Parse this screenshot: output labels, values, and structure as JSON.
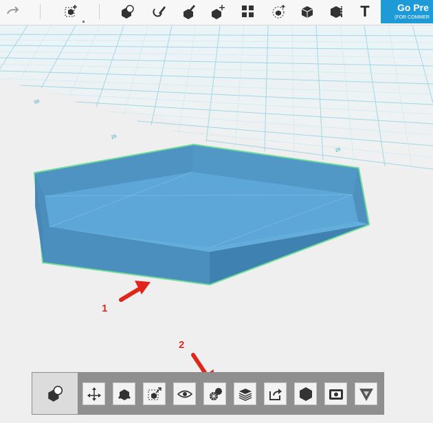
{
  "top_toolbar": {
    "tools": [
      {
        "name": "redo-icon"
      },
      {
        "name": "transform-icon"
      },
      {
        "name": "primitives-icon"
      },
      {
        "name": "sketch-icon"
      },
      {
        "name": "construct-icon"
      },
      {
        "name": "modify-icon"
      },
      {
        "name": "pattern-icon"
      },
      {
        "name": "grouping-icon"
      },
      {
        "name": "combine-icon"
      },
      {
        "name": "measure-icon"
      },
      {
        "name": "text-icon"
      }
    ],
    "text_tool_label": "T",
    "go_premium": {
      "label": "Go Pre",
      "sub_label": "(FOR COMMER"
    }
  },
  "grid": {
    "labels": [
      "50",
      "25",
      "25"
    ]
  },
  "annotations": [
    {
      "label": "1"
    },
    {
      "label": "2"
    }
  ],
  "colors": {
    "accent": "#1e9ad6",
    "model": "#5aa7d6",
    "selection": "#6fdc9a",
    "annotation": "#e0251b"
  },
  "bottom_toolbar": {
    "tools": [
      {
        "name": "shape-icon"
      },
      {
        "name": "move-icon"
      },
      {
        "name": "smart-scale-icon"
      },
      {
        "name": "scale-icon"
      },
      {
        "name": "hide-icon"
      },
      {
        "name": "material-icon"
      },
      {
        "name": "slice-icon"
      },
      {
        "name": "export-icon"
      },
      {
        "name": "solid-icon"
      },
      {
        "name": "snapshot-icon"
      },
      {
        "name": "print-icon"
      }
    ]
  }
}
